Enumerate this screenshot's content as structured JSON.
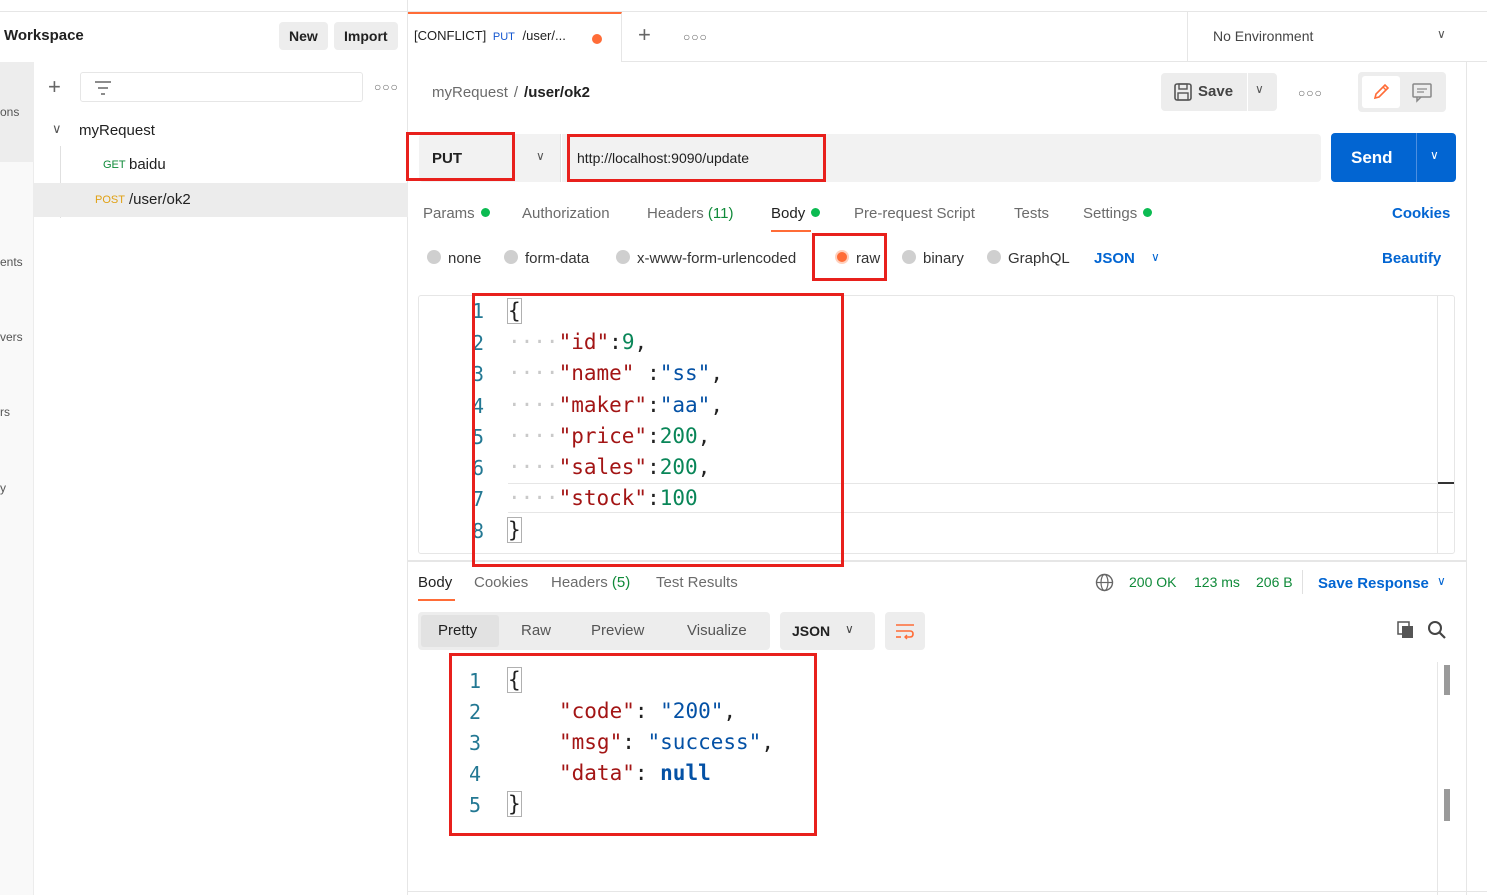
{
  "sidebar": {
    "workspace_title": "Workspace",
    "new_label": "New",
    "import_label": "Import",
    "rail_labels": [
      "ons",
      "ents",
      "vers",
      "rs",
      "y"
    ],
    "folder": {
      "name": "myRequest",
      "items": [
        {
          "method": "GET",
          "name": "baidu"
        },
        {
          "method": "POST",
          "name": "/user/ok2"
        }
      ]
    },
    "icons": [
      "plus-icon",
      "filter-icon",
      "more-icon",
      "chevron-down-icon"
    ]
  },
  "tabs": {
    "active": {
      "conflict": "[CONFLICT]",
      "method": "PUT",
      "title": "/user/..."
    },
    "environment": "No Environment"
  },
  "request": {
    "breadcrumb": {
      "parent": "myRequest",
      "separator": "/",
      "current": "/user/ok2"
    },
    "save_label": "Save",
    "method": "PUT",
    "url": "http://localhost:9090/update",
    "send_label": "Send",
    "tabs": {
      "params": "Params",
      "authorization": "Authorization",
      "headers": "Headers",
      "headers_count": "(11)",
      "body": "Body",
      "prerequest": "Pre-request Script",
      "tests": "Tests",
      "settings": "Settings"
    },
    "cookies_label": "Cookies",
    "body_types": {
      "none": "none",
      "form_data": "form-data",
      "urlencoded": "x-www-form-urlencoded",
      "raw": "raw",
      "binary": "binary",
      "graphql": "GraphQL"
    },
    "selected_body_type": "raw",
    "language": "JSON",
    "beautify_label": "Beautify",
    "code": {
      "line_numbers": [
        "1",
        "2",
        "3",
        "4",
        "5",
        "6",
        "7",
        "8"
      ],
      "open": "{",
      "close": "}",
      "fields": [
        {
          "key": "\"id\"",
          "sep": ":",
          "value": "9",
          "trail": ","
        },
        {
          "key": "\"name\"",
          "sep": " :",
          "value": "\"ss\"",
          "trail": ","
        },
        {
          "key": "\"maker\"",
          "sep": ":",
          "value": "\"aa\"",
          "trail": ","
        },
        {
          "key": "\"price\"",
          "sep": ":",
          "value": "200",
          "trail": ","
        },
        {
          "key": "\"sales\"",
          "sep": ":",
          "value": "200",
          "trail": ","
        },
        {
          "key": "\"stock\"",
          "sep": ":",
          "value": "100",
          "trail": ""
        }
      ]
    }
  },
  "response": {
    "tabs": {
      "body": "Body",
      "cookies": "Cookies",
      "headers": "Headers",
      "headers_count": "(5)",
      "test_results": "Test Results"
    },
    "status": "200 OK",
    "time": "123 ms",
    "size": "206 B",
    "save_response_label": "Save Response",
    "views": {
      "pretty": "Pretty",
      "raw": "Raw",
      "preview": "Preview",
      "visualize": "Visualize"
    },
    "format": "JSON",
    "code": {
      "line_numbers": [
        "1",
        "2",
        "3",
        "4",
        "5"
      ],
      "open": "{",
      "close": "}",
      "fields": [
        {
          "key": "\"code\"",
          "value": "\"200\"",
          "trail": ","
        },
        {
          "key": "\"msg\"",
          "value": "\"success\"",
          "trail": ","
        },
        {
          "key": "\"data\"",
          "value": "null",
          "trail": ""
        }
      ]
    }
  },
  "colors": {
    "accent": "#ff6c37",
    "send_blue": "#0265d2",
    "status_green": "#0f8a39",
    "annotation_red": "#e8201c"
  }
}
